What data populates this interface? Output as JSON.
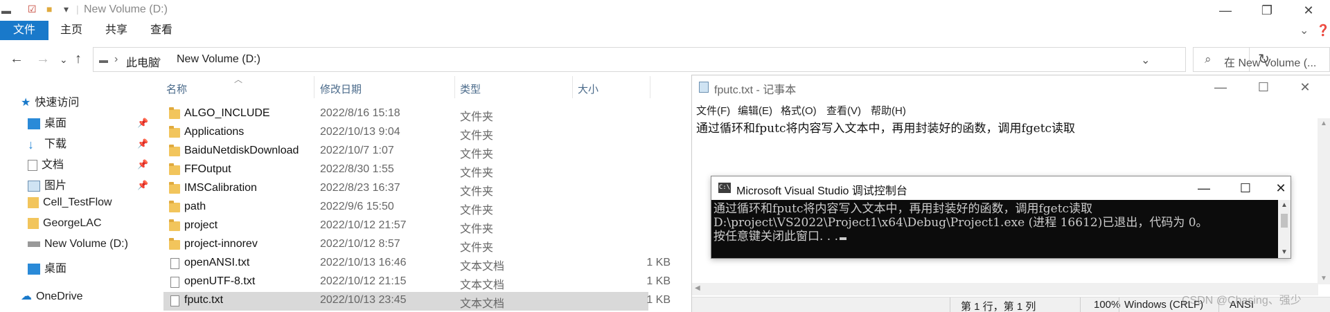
{
  "explorer": {
    "title": "New Volume (D:)",
    "ribbon_tabs": [
      "文件",
      "主页",
      "共享",
      "查看"
    ],
    "address": {
      "crumbs": [
        "此电脑",
        "New Volume (D:)"
      ],
      "chevron": "›"
    },
    "search_placeholder": "在 New Volume (...",
    "nav": {
      "quick_access": "快速访问",
      "items": [
        "桌面",
        "下载",
        "文档",
        "图片",
        "Cell_TestFlow",
        "GeorgeLAC",
        "New Volume (D:)",
        "桌面"
      ],
      "onedrive": "OneDrive"
    },
    "columns": {
      "name": "名称",
      "date": "修改日期",
      "type": "类型",
      "size": "大小"
    },
    "files": [
      {
        "name": "ALGO_INCLUDE",
        "date": "2022/8/16 15:18",
        "type": "文件夹",
        "size": "",
        "kind": "folder"
      },
      {
        "name": "Applications",
        "date": "2022/10/13 9:04",
        "type": "文件夹",
        "size": "",
        "kind": "folder"
      },
      {
        "name": "BaiduNetdiskDownload",
        "date": "2022/10/7 1:07",
        "type": "文件夹",
        "size": "",
        "kind": "folder"
      },
      {
        "name": "FFOutput",
        "date": "2022/8/30 1:55",
        "type": "文件夹",
        "size": "",
        "kind": "folder"
      },
      {
        "name": "IMSCalibration",
        "date": "2022/8/23 16:37",
        "type": "文件夹",
        "size": "",
        "kind": "folder"
      },
      {
        "name": "path",
        "date": "2022/9/6 15:50",
        "type": "文件夹",
        "size": "",
        "kind": "folder"
      },
      {
        "name": "project",
        "date": "2022/10/12 21:57",
        "type": "文件夹",
        "size": "",
        "kind": "folder"
      },
      {
        "name": "project-innorev",
        "date": "2022/10/12 8:57",
        "type": "文件夹",
        "size": "",
        "kind": "folder"
      },
      {
        "name": "openANSI.txt",
        "date": "2022/10/13 16:46",
        "type": "文本文档",
        "size": "1 KB",
        "kind": "txt"
      },
      {
        "name": "openUTF-8.txt",
        "date": "2022/10/12 21:15",
        "type": "文本文档",
        "size": "1 KB",
        "kind": "txt"
      },
      {
        "name": "fputc.txt",
        "date": "2022/10/13 23:45",
        "type": "文本文档",
        "size": "1 KB",
        "kind": "txt",
        "selected": true
      }
    ]
  },
  "notepad": {
    "title": "fputc.txt - 记事本",
    "menu": [
      "文件(F)",
      "编辑(E)",
      "格式(O)",
      "查看(V)",
      "帮助(H)"
    ],
    "content": "通过循环和fputc将内容写入文本中，再用封装好的函数，调用fgetc读取",
    "status": {
      "position": "第 1 行，第 1 列",
      "zoom": "100%",
      "line_ending": "Windows (CRLF)",
      "encoding": "ANSI"
    }
  },
  "console": {
    "title": "Microsoft Visual Studio 调试控制台",
    "icon_text": "C:\\",
    "lines": [
      "通过循环和fputc将内容写入文本中，再用封装好的函数，调用fgetc读取",
      "D:\\project\\VS2022\\Project1\\x64\\Debug\\Project1.exe (进程 16612)已退出，代码为 0。",
      "按任意键关闭此窗口. . ."
    ]
  },
  "watermark": "CSDN @Chasing、强少",
  "colors": {
    "accent": "#1979ca",
    "selected_row": "#d9d9d9",
    "console_bg": "#0c0c0c",
    "console_fg": "#cccccc"
  }
}
